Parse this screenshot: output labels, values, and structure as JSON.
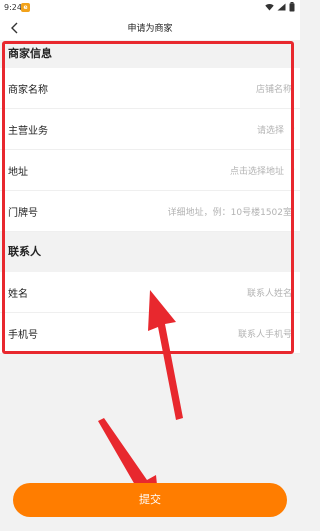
{
  "status_bar": {
    "time": "9:24",
    "app_badge": "e"
  },
  "nav": {
    "title": "申请为商家"
  },
  "sections": {
    "merchant": {
      "header": "商家信息",
      "rows": [
        {
          "label": "商家名称",
          "value": "店铺名称",
          "arrow": false
        },
        {
          "label": "主营业务",
          "value": "请选择",
          "arrow": true
        },
        {
          "label": "地址",
          "value": "点击选择地址",
          "arrow": true
        },
        {
          "label": "门牌号",
          "value": "详细地址，例：10号楼1502室",
          "arrow": false
        }
      ]
    },
    "contact": {
      "header": "联系人",
      "rows": [
        {
          "label": "姓名",
          "value": "联系人姓名",
          "arrow": false
        },
        {
          "label": "手机号",
          "value": "联系人手机号",
          "arrow": false
        }
      ]
    }
  },
  "submit": {
    "label": "提交"
  },
  "colors": {
    "accent": "#ff7d00",
    "annotation": "#e8282e"
  },
  "icons": {
    "back": "chevron-left-icon",
    "arrow": "chevron-right-icon"
  }
}
